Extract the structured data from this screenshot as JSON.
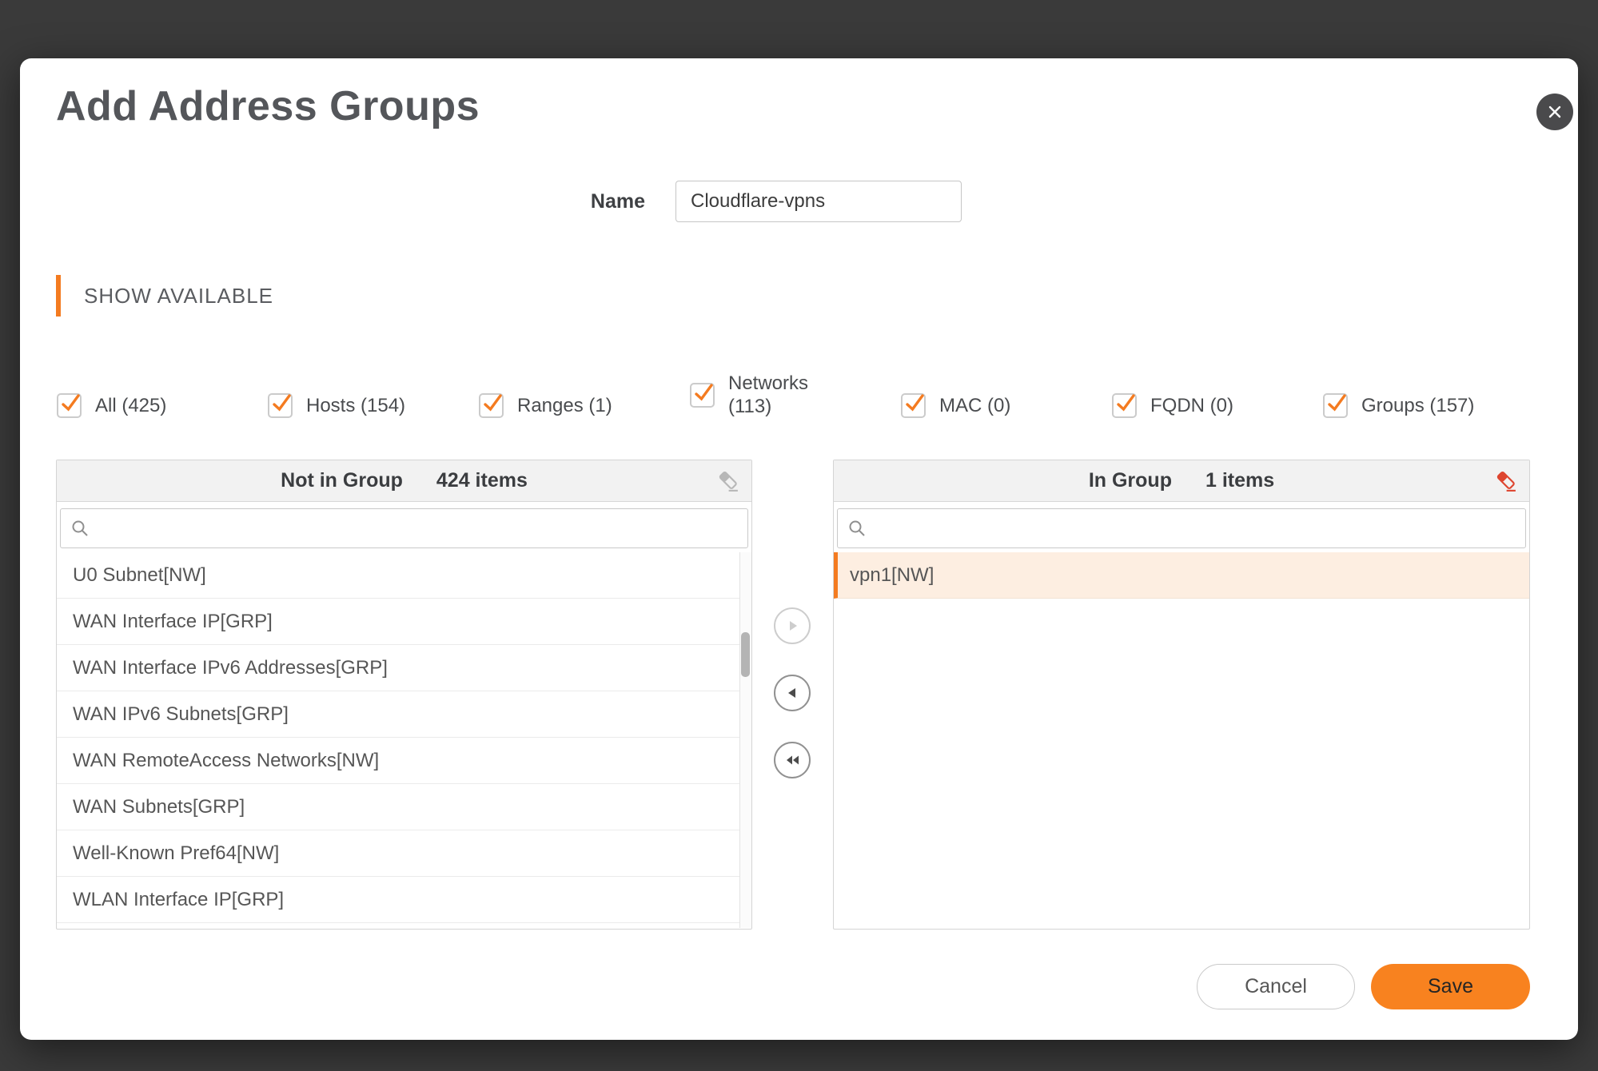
{
  "dialog": {
    "title": "Add Address Groups"
  },
  "name_field": {
    "label": "Name",
    "value": "Cloudflare-vpns"
  },
  "section": {
    "label": "SHOW AVAILABLE"
  },
  "filters": [
    {
      "label": "All (425)",
      "checked": true
    },
    {
      "label": "Hosts (154)",
      "checked": true
    },
    {
      "label": "Ranges (1)",
      "checked": true
    },
    {
      "label": "Networks",
      "sublabel": "(113)",
      "checked": true
    },
    {
      "label": "MAC (0)",
      "checked": true
    },
    {
      "label": "FQDN (0)",
      "checked": true
    },
    {
      "label": "Groups (157)",
      "checked": true
    }
  ],
  "not_in_group": {
    "title": "Not in Group",
    "count": "424 items",
    "search_value": "",
    "items": [
      "U0 Subnet[NW]",
      "WAN Interface IP[GRP]",
      "WAN Interface IPv6 Addresses[GRP]",
      "WAN IPv6 Subnets[GRP]",
      "WAN RemoteAccess Networks[NW]",
      "WAN Subnets[GRP]",
      "Well-Known Pref64[NW]",
      "WLAN Interface IP[GRP]"
    ]
  },
  "in_group": {
    "title": "In Group",
    "count": "1 items",
    "search_value": "",
    "items": [
      "vpn1[NW]"
    ],
    "selected_item": "vpn1[NW]"
  },
  "footer": {
    "cancel_label": "Cancel",
    "save_label": "Save"
  },
  "icons": {
    "close-icon": "✕",
    "search-icon": "magnifier",
    "eraser-icon": "eraser",
    "move-right-icon": "▶",
    "move-left-icon": "◀",
    "move-all-left-icon": "◀◀"
  },
  "colors": {
    "accent": "#f47b20",
    "selected_row_bg": "#fdeee1",
    "eraser_active": "#de452f",
    "overlay": "#3a3a3a"
  }
}
